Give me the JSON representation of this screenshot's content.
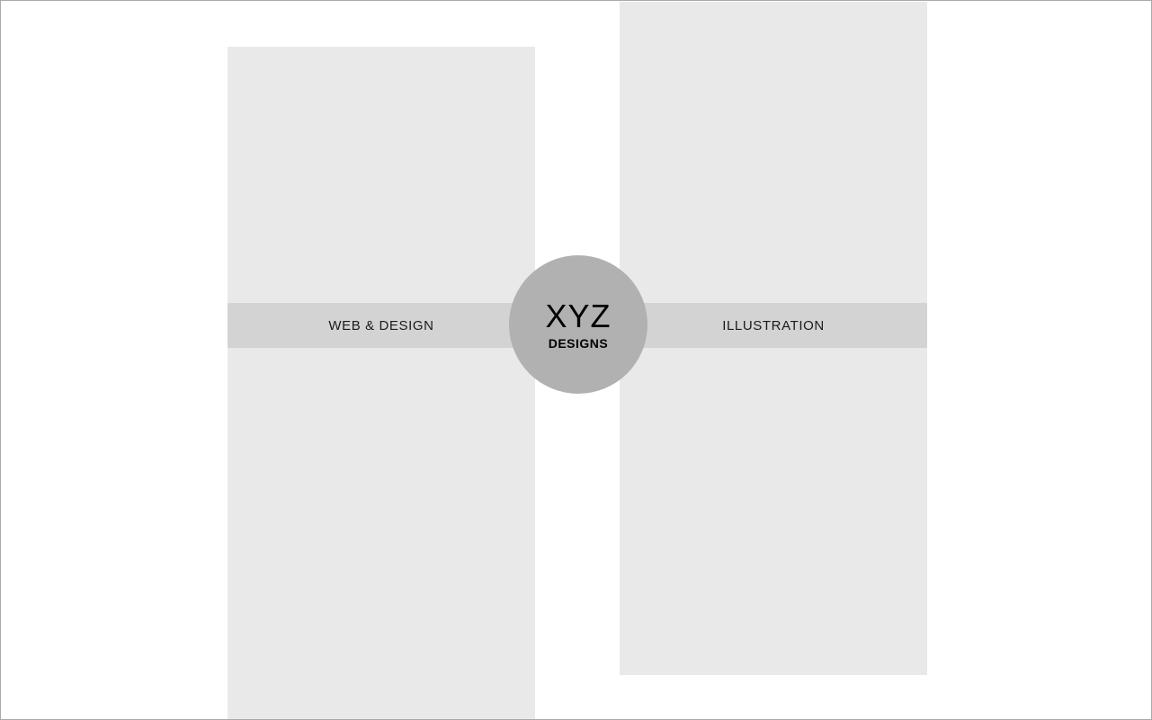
{
  "colors": {
    "background": "#ffffff",
    "panel": "#e9e9e9",
    "band": "#d3d3d3",
    "logo_circle": "#b1b1b1",
    "text": "#1b1b1b"
  },
  "sections": [
    {
      "label": "WEB & DESIGN"
    },
    {
      "label": "ILLUSTRATION"
    }
  ],
  "logo": {
    "main": "XYZ",
    "sub": "DESIGNS"
  }
}
